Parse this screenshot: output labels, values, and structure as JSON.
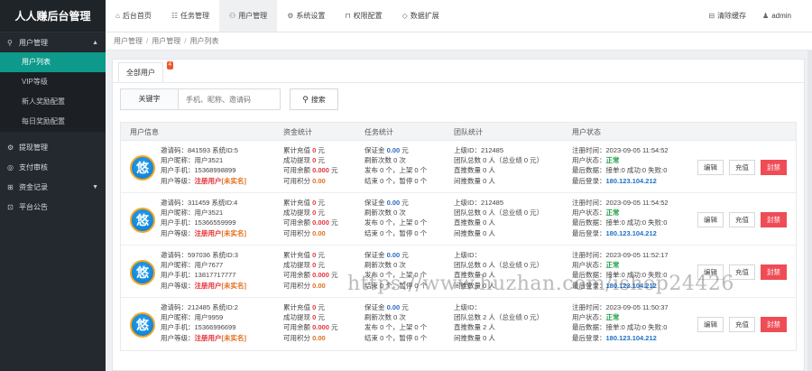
{
  "app": {
    "title": "人人赚后台管理"
  },
  "sidebar": {
    "groups": [
      {
        "icon": "user-icon",
        "glyph": "⚲",
        "label": "用户管理",
        "expanded": true,
        "items": [
          {
            "label": "用户列表",
            "active": true
          },
          {
            "label": "VIP等级",
            "active": false
          },
          {
            "label": "新人奖励配置",
            "active": false
          },
          {
            "label": "每日奖励配置",
            "active": false
          }
        ]
      },
      {
        "icon": "gear-icon",
        "glyph": "⚙",
        "label": "提现管理"
      },
      {
        "icon": "money-icon",
        "glyph": "◎",
        "label": "支付审核"
      },
      {
        "icon": "record-icon",
        "glyph": "⊞",
        "label": "资金记录",
        "has_caret": true
      },
      {
        "icon": "notice-icon",
        "glyph": "⊡",
        "label": "平台公告"
      }
    ]
  },
  "topbar": {
    "tabs": [
      {
        "icon": "home-icon",
        "glyph": "⌂",
        "label": "后台首页",
        "active": false
      },
      {
        "icon": "task-icon",
        "glyph": "☷",
        "label": "任务管理",
        "active": false
      },
      {
        "icon": "user-icon",
        "glyph": "⚇",
        "label": "用户管理",
        "active": true
      },
      {
        "icon": "settings-icon",
        "glyph": "⚙",
        "label": "系统设置",
        "active": false
      },
      {
        "icon": "lock-icon",
        "glyph": "⊓",
        "label": "权限配置",
        "active": false
      },
      {
        "icon": "diamond-icon",
        "glyph": "◇",
        "label": "数据扩展",
        "active": false
      }
    ],
    "clear_cache": {
      "icon": "trash-icon",
      "glyph": "⊟",
      "label": "清除缓存"
    },
    "admin": {
      "icon": "person-icon",
      "glyph": "♟",
      "label": "admin"
    }
  },
  "breadcrumb": [
    "用户管理",
    "用户管理",
    "用户列表"
  ],
  "panel": {
    "tab_label": "全部用户",
    "tab_badge": "4",
    "search": {
      "keyword_label": "关键字",
      "placeholder": "手机、昵称、邀请码",
      "button_label": "搜索"
    }
  },
  "table": {
    "headers": [
      "用户信息",
      "资金统计",
      "任务统计",
      "团队统计",
      "用户状态"
    ],
    "rows": [
      {
        "info": {
          "invite": "邀请码：841593 系统ID:5",
          "nickname": "用户昵称：用户3521",
          "phone": "用户手机：15368998899",
          "level_prefix": "用户等级：",
          "level": "注册用户",
          "realname": "[未实名]"
        },
        "fund": {
          "total_prefix": "累计充值 ",
          "total": "0",
          "total_unit": " 元",
          "withdraw_prefix": "成功提现 ",
          "withdraw": "0",
          "withdraw_unit": " 元",
          "balance_prefix": "可用余额 ",
          "balance": "0.000",
          "balance_unit": " 元",
          "points_prefix": "可用积分 ",
          "points": "0.00"
        },
        "task": {
          "deposit_prefix": "保证金 ",
          "deposit": "0.00",
          "deposit_unit": " 元",
          "refresh": "刷新次数 0 次",
          "publish": "发布 0 个，上架 0 个",
          "end": "结束 0 个，暂停 0 个"
        },
        "team": {
          "parent": "上级ID：212485",
          "total": "团队总数 0 人（总业绩 0 元）",
          "direct": "直推数量 0 人",
          "indirect": "间推数量 0 人"
        },
        "status": {
          "reg": "注册时间：2023-09-05 11:54:52",
          "state_prefix": "用户状态：",
          "state": "正常",
          "login_prefix": "最后数据：",
          "login_stats": "接单:0 成功:0 失败:0",
          "ip_prefix": "最后登录：",
          "ip": "180.123.104.212"
        },
        "actions": [
          "编辑",
          "充值",
          "封禁"
        ]
      },
      {
        "info": {
          "invite": "邀请码：311459 系统ID:4",
          "nickname": "用户昵称：用户3521",
          "phone": "用户手机：15366559999",
          "level_prefix": "用户等级：",
          "level": "注册用户",
          "realname": "[未实名]"
        },
        "fund": {
          "total_prefix": "累计充值 ",
          "total": "0",
          "total_unit": " 元",
          "withdraw_prefix": "成功提现 ",
          "withdraw": "0",
          "withdraw_unit": " 元",
          "balance_prefix": "可用余额 ",
          "balance": "0.000",
          "balance_unit": " 元",
          "points_prefix": "可用积分 ",
          "points": "0.00"
        },
        "task": {
          "deposit_prefix": "保证金 ",
          "deposit": "0.00",
          "deposit_unit": " 元",
          "refresh": "刷新次数 0 次",
          "publish": "发布 0 个，上架 0 个",
          "end": "结束 0 个，暂停 0 个"
        },
        "team": {
          "parent": "上级ID：212485",
          "total": "团队总数 0 人（总业绩 0 元）",
          "direct": "直推数量 0 人",
          "indirect": "间推数量 0 人"
        },
        "status": {
          "reg": "注册时间：2023-09-05 11:54:52",
          "state_prefix": "用户状态：",
          "state": "正常",
          "login_prefix": "最后数据：",
          "login_stats": "接单:0 成功:0 失败:0",
          "ip_prefix": "最后登录：",
          "ip": "180.123.104.212"
        },
        "actions": [
          "编辑",
          "充值",
          "封禁"
        ]
      },
      {
        "info": {
          "invite": "邀请码：597036 系统ID:3",
          "nickname": "用户昵称：用户7677",
          "phone": "用户手机：13817717777",
          "level_prefix": "用户等级：",
          "level": "注册用户",
          "realname": "[未实名]"
        },
        "fund": {
          "total_prefix": "累计充值 ",
          "total": "0",
          "total_unit": " 元",
          "withdraw_prefix": "成功提现 ",
          "withdraw": "0",
          "withdraw_unit": " 元",
          "balance_prefix": "可用余额 ",
          "balance": "0.000",
          "balance_unit": " 元",
          "points_prefix": "可用积分 ",
          "points": "0.00"
        },
        "task": {
          "deposit_prefix": "保证金 ",
          "deposit": "0.00",
          "deposit_unit": " 元",
          "refresh": "刷新次数 0 次",
          "publish": "发布 0 个，上架 0 个",
          "end": "结束 0 个，暂停 0 个"
        },
        "team": {
          "parent": "上级ID：",
          "total": "团队总数 0 人（总业绩 0 元）",
          "direct": "直推数量 0 人",
          "indirect": "间推数量 0 人"
        },
        "status": {
          "reg": "注册时间：2023-09-05 11:52:17",
          "state_prefix": "用户状态：",
          "state": "正常",
          "login_prefix": "最后数据：",
          "login_stats": "接单:0 成功:0 失败:0",
          "ip_prefix": "最后登录：",
          "ip": "180.123.104.212"
        },
        "actions": [
          "编辑",
          "充值",
          "封禁"
        ]
      },
      {
        "info": {
          "invite": "邀请码：212485 系统ID:2",
          "nickname": "用户昵称：用户9959",
          "phone": "用户手机：15366996699",
          "level_prefix": "用户等级：",
          "level": "注册用户",
          "realname": "[未实名]"
        },
        "fund": {
          "total_prefix": "累计充值 ",
          "total": "0",
          "total_unit": " 元",
          "withdraw_prefix": "成功提现 ",
          "withdraw": "0",
          "withdraw_unit": " 元",
          "balance_prefix": "可用余额 ",
          "balance": "0.000",
          "balance_unit": " 元",
          "points_prefix": "可用积分 ",
          "points": "0.00"
        },
        "task": {
          "deposit_prefix": "保证金 ",
          "deposit": "0.00",
          "deposit_unit": " 元",
          "refresh": "刷新次数 0 次",
          "publish": "发布 0 个，上架 0 个",
          "end": "结束 0 个，暂停 0 个"
        },
        "team": {
          "parent": "上级ID：",
          "total": "团队总数 2 人（总业绩 0 元）",
          "direct": "直推数量 2 人",
          "indirect": "间推数量 0 人"
        },
        "status": {
          "reg": "注册时间：2023-09-05 11:50:37",
          "state_prefix": "用户状态：",
          "state": "正常",
          "login_prefix": "最后数据：",
          "login_stats": "接单:0 成功:0 失败:0",
          "ip_prefix": "最后登录：",
          "ip": "180.123.104.212"
        },
        "actions": [
          "编辑",
          "充值",
          "封禁"
        ]
      }
    ]
  },
  "watermark": "https://www.huzhan.com/ishop24426",
  "avatar_glyph": "悠",
  "colors": {
    "sidebar_bg": "#24292f",
    "active_item": "#0d9a8b",
    "ban_button": "#ef4c56",
    "badge": "#f0562c"
  }
}
